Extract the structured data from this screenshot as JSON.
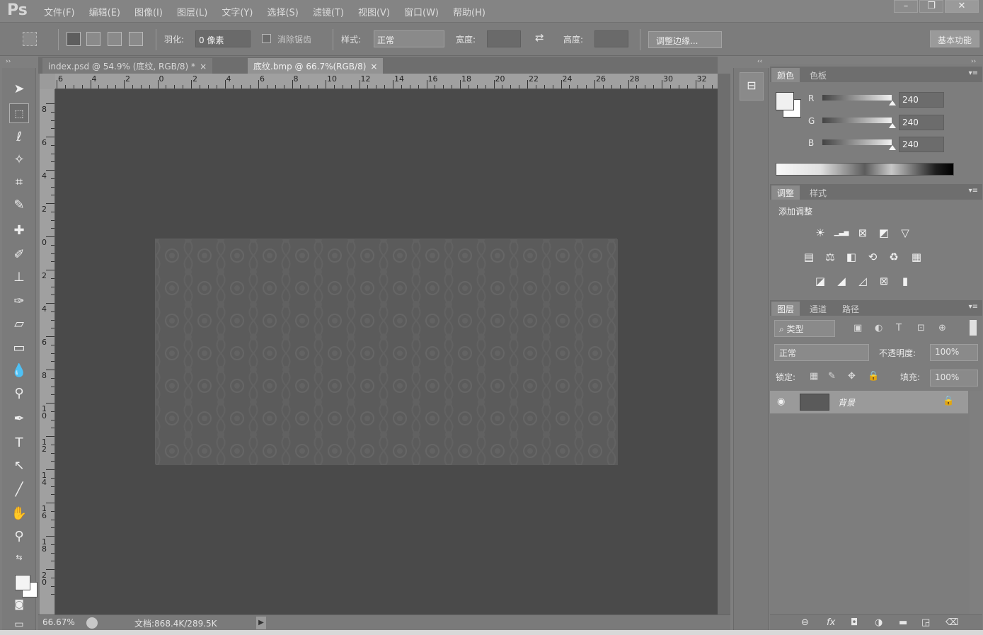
{
  "app": {
    "logo": "Ps"
  },
  "menubar": {
    "items": [
      "文件(F)",
      "编辑(E)",
      "图像(I)",
      "图层(L)",
      "文字(Y)",
      "选择(S)",
      "滤镜(T)",
      "视图(V)",
      "窗口(W)",
      "帮助(H)"
    ]
  },
  "window_controls": {
    "minimize": "–",
    "restore": "❐",
    "close": "✕"
  },
  "options": {
    "feather_label": "羽化:",
    "feather_value": "0 像素",
    "antialias_label": "消除锯齿",
    "style_label": "样式:",
    "style_value": "正常",
    "width_label": "宽度:",
    "height_label": "高度:",
    "refine_edge": "调整边缘...",
    "workspace": "基本功能"
  },
  "tabs": [
    {
      "label": "index.psd @ 54.9% (底纹, RGB/8) *",
      "close": "×"
    },
    {
      "label": "底纹.bmp @ 66.7%(RGB/8)",
      "close": "×"
    }
  ],
  "ruler_h": {
    "labels": [
      "6",
      "4",
      "2",
      "0",
      "2",
      "4",
      "6",
      "8",
      "10",
      "12",
      "14",
      "16",
      "18",
      "20",
      "22",
      "24",
      "26",
      "28",
      "30",
      "32"
    ]
  },
  "ruler_v": {
    "labels": [
      "8",
      "6",
      "4",
      "2",
      "0",
      "2",
      "4",
      "6",
      "8",
      "1\n0",
      "1\n2",
      "1\n4",
      "1\n6",
      "1\n8",
      "2\n0"
    ]
  },
  "status": {
    "zoom": "66.67%",
    "doc": "文档:868.4K/289.5K",
    "arrow": "▶"
  },
  "color_panel": {
    "tabs": [
      "颜色",
      "色板"
    ],
    "channels": [
      {
        "label": "R",
        "value": "240"
      },
      {
        "label": "G",
        "value": "240"
      },
      {
        "label": "B",
        "value": "240"
      }
    ],
    "foreground": "#f0f0f0",
    "background": "#ffffff"
  },
  "adjust_panel": {
    "tabs": [
      "调整",
      "样式"
    ],
    "title": "添加调整",
    "rows": [
      [
        "☀",
        "▁▃▅",
        "⊠",
        "◩",
        "▽"
      ],
      [
        "▤",
        "⚖",
        "◧",
        "⟲",
        "♻",
        "▦"
      ],
      [
        "◪",
        "◢",
        "◿",
        "⊠",
        "▮"
      ]
    ]
  },
  "layers_panel": {
    "tabs": [
      "图层",
      "通道",
      "路径"
    ],
    "filter_type": "⌕ 类型",
    "filter_icons": [
      "▣",
      "◐",
      "T",
      "⊡",
      "⊕"
    ],
    "blend_mode": "正常",
    "opacity_label": "不透明度:",
    "opacity_value": "100%",
    "lock_label": "锁定:",
    "fill_label": "填充:",
    "fill_value": "100%",
    "layers": [
      {
        "name": "背景",
        "visible": true,
        "locked": true
      }
    ],
    "footer_icons": [
      "⊖",
      "fx",
      "◘",
      "◑",
      "▬",
      "◲",
      "⌫"
    ]
  },
  "panel_menu": "▾≡",
  "collapse_left": "››",
  "collapse_right": "‹‹",
  "mid_panel_icon": "⊟"
}
